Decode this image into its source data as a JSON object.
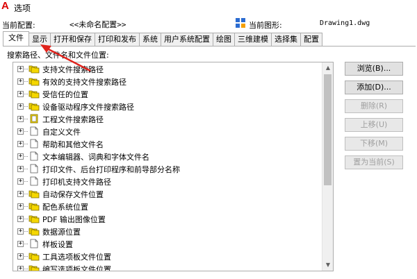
{
  "window": {
    "title": "选项",
    "logo": "A"
  },
  "profile": {
    "current_profile_label": "当前配置:",
    "current_profile_value": "<<未命名配置>>",
    "current_drawing_label": "当前图形:",
    "current_drawing_value": "Drawing1.dwg"
  },
  "tabs": [
    {
      "label": "文件"
    },
    {
      "label": "显示"
    },
    {
      "label": "打开和保存"
    },
    {
      "label": "打印和发布"
    },
    {
      "label": "系统"
    },
    {
      "label": "用户系统配置"
    },
    {
      "label": "绘图"
    },
    {
      "label": "三维建模"
    },
    {
      "label": "选择集"
    },
    {
      "label": "配置"
    }
  ],
  "search_label": "搜索路径、文件名和文件位置:",
  "tree": [
    {
      "label": "支持文件搜索路径",
      "icon": "folder-stack-icon"
    },
    {
      "label": "有效的支持文件搜索路径",
      "icon": "folder-stack-icon"
    },
    {
      "label": "受信任的位置",
      "icon": "folder-stack-icon"
    },
    {
      "label": "设备驱动程序文件搜索路径",
      "icon": "folder-stack-icon"
    },
    {
      "label": "工程文件搜索路径",
      "icon": "project-icon"
    },
    {
      "label": "自定义文件",
      "icon": "document-icon"
    },
    {
      "label": "帮助和其他文件名",
      "icon": "document-icon"
    },
    {
      "label": "文本编辑器、词典和字体文件名",
      "icon": "document-icon"
    },
    {
      "label": "打印文件、后台打印程序和前导部分名称",
      "icon": "document-icon"
    },
    {
      "label": "打印机支持文件路径",
      "icon": "document-icon"
    },
    {
      "label": "自动保存文件位置",
      "icon": "folder-stack-icon"
    },
    {
      "label": "配色系统位置",
      "icon": "folder-stack-icon"
    },
    {
      "label": "PDF 输出图像位置",
      "icon": "folder-stack-icon"
    },
    {
      "label": "数据源位置",
      "icon": "folder-stack-icon"
    },
    {
      "label": "样板设置",
      "icon": "document-icon"
    },
    {
      "label": "工具选项板文件位置",
      "icon": "folder-stack-icon"
    },
    {
      "label": "编写选项板文件位置",
      "icon": "folder-stack-icon"
    }
  ],
  "buttons": {
    "browse": "浏览(B)...",
    "add": "添加(D)...",
    "delete": "删除(R)",
    "move_up": "上移(U)",
    "move_down": "下移(M)",
    "set_current": "置为当前(S)"
  },
  "colors": {
    "folder": "#f5d700",
    "arrow": "#e0231c"
  }
}
